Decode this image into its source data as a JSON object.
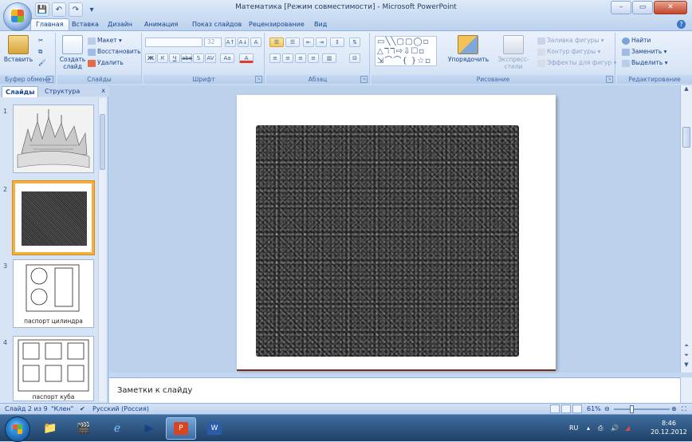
{
  "window": {
    "title": "Математика [Режим совместимости] - Microsoft PowerPoint",
    "controls": {
      "minimize": "–",
      "maximize": "▭",
      "close": "✕"
    }
  },
  "quick_access": {
    "save": "💾",
    "undo": "↶",
    "redo": "↷",
    "more": "▾"
  },
  "ribbon_tabs": [
    "Главная",
    "Вставка",
    "Дизайн",
    "Анимация",
    "Показ слайдов",
    "Рецензирование",
    "Вид"
  ],
  "active_tab": "Главная",
  "ribbon": {
    "clipboard": {
      "label": "Буфер обмена",
      "paste": "Вставить"
    },
    "slides": {
      "label": "Слайды",
      "new_slide": "Создать слайд",
      "layout": "Макет ▾",
      "reset": "Восстановить",
      "delete": "Удалить"
    },
    "font": {
      "label": "Шрифт",
      "font_name": "",
      "font_size": "32",
      "bold": "Ж",
      "italic": "К",
      "underline": "Ч",
      "strike": "abe",
      "shadow": "S",
      "spacing": "AV",
      "case": "Aa",
      "color": "A",
      "grow": "A↑",
      "shrink": "A↓",
      "clear": "A"
    },
    "paragraph": {
      "label": "Абзац"
    },
    "drawing": {
      "label": "Рисование",
      "shapes_row1": "▭╲╲▢▢◯▫",
      "shapes_row2": "△ℸℸ⇨⇩☐▫",
      "shapes_row3": "⇲⌒⌒{ }☆▫",
      "arrange": "Упорядочить",
      "quick_styles": "Экспресс-стили",
      "fill": "Заливка фигуры ▾",
      "outline": "Контур фигуры ▾",
      "effects": "Эффекты для фигур ▾"
    },
    "editing": {
      "label": "Редактирование",
      "find": "Найти",
      "replace": "Заменить ▾",
      "select": "Выделить ▾"
    }
  },
  "slides_panel": {
    "tabs": [
      "Слайды",
      "Структура"
    ],
    "close": "x",
    "thumbnails": [
      {
        "num": "1",
        "caption": ""
      },
      {
        "num": "2",
        "caption": ""
      },
      {
        "num": "3",
        "caption": "паспорт цилиндра"
      },
      {
        "num": "4",
        "caption": "паспорт куба"
      }
    ]
  },
  "notes": {
    "placeholder": "Заметки к слайду"
  },
  "status": {
    "slide_info": "Слайд 2 из 9",
    "theme": "\"Клен\"",
    "language": "Русский (Россия)",
    "zoom": "61%"
  },
  "taskbar": {
    "lang": "RU",
    "time": "8:46",
    "date": "20.12.2012"
  },
  "colors": {
    "ribbon_bg": "#d9e6f7",
    "selected_thumb_border": "#f4b03f",
    "taskbar": "#1f4168"
  }
}
